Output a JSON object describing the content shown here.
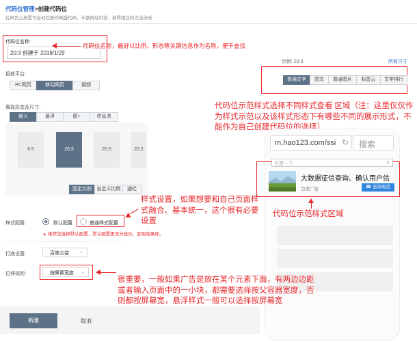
{
  "breadcrumb": {
    "parent": "代码位管理",
    "sep": ">",
    "current": "创建代码位"
  },
  "subtitle": "在网页上放置可自动匹配的网盟代码，丰富网站内容，获得相应的点击分成",
  "name_field": {
    "label": "代码位名称:",
    "value": "20:3 创建于 2018/1/29"
  },
  "platform": {
    "label": "投放平台:",
    "tabs": [
      "PC网页",
      "移动网页",
      "视频"
    ],
    "selected": 1
  },
  "display": {
    "label": "展现形态及尺寸:",
    "tabs": [
      "嵌入",
      "悬浮",
      "图+",
      "信息流"
    ],
    "selected": 0,
    "ratios": [
      "6:5",
      "20:3",
      "20:5",
      "20:2"
    ],
    "selected_ratio": 1,
    "size_tabs": [
      "固定比例",
      "自定义比例",
      "通栏"
    ]
  },
  "preview": {
    "example_label": "示例:",
    "example_value": "20:3",
    "all_link": "所有尺寸",
    "style_tabs": [
      "普通文字",
      "图文",
      "普通图片",
      "标签云",
      "文字排行"
    ],
    "url": "m.hao123.com/ssi",
    "search": "搜索",
    "input": "百度一下",
    "ad_title": "大数据征信查询、确认用户信",
    "ad_source": "百度广告",
    "ad_button": "咨询电话"
  },
  "style_config": {
    "label": "样式配置:",
    "options": [
      "默认配置",
      "普通样式配置"
    ],
    "warning": "推荐您选择默认配置，默认配置更充分自价、变现效果好。"
  },
  "dahuan": {
    "label": "打底设置:",
    "value": "百度公益"
  },
  "stretch": {
    "label": "拉伸规则:",
    "value": "按屏幕宽度"
  },
  "buttons": {
    "primary": "新建",
    "cancel": "取消"
  },
  "annotations": {
    "name_note": "代码位名称，最好以比例、形态等关键信息作为名称，便于查找",
    "style_note": "代码位示范样式选择不同样式查看 区域（注：这里仅仅作为样式示范以及该样式形态下有哪些不同的展示形式，不能作为自己创建代码位的选择）",
    "demo_note": "代码位示范样式区域",
    "config_note": "样式设置，如果想要和自己页面样式融合、基本统一，这个很有必要设置",
    "stretch_note": "很重要，一般如果广告是放在某个元素下面，有两边边距或者输入页面中的一小块，都需要选择按父容器宽度，否则都按屏幕宽，悬浮样式一般可以选择按屏幕宽"
  }
}
